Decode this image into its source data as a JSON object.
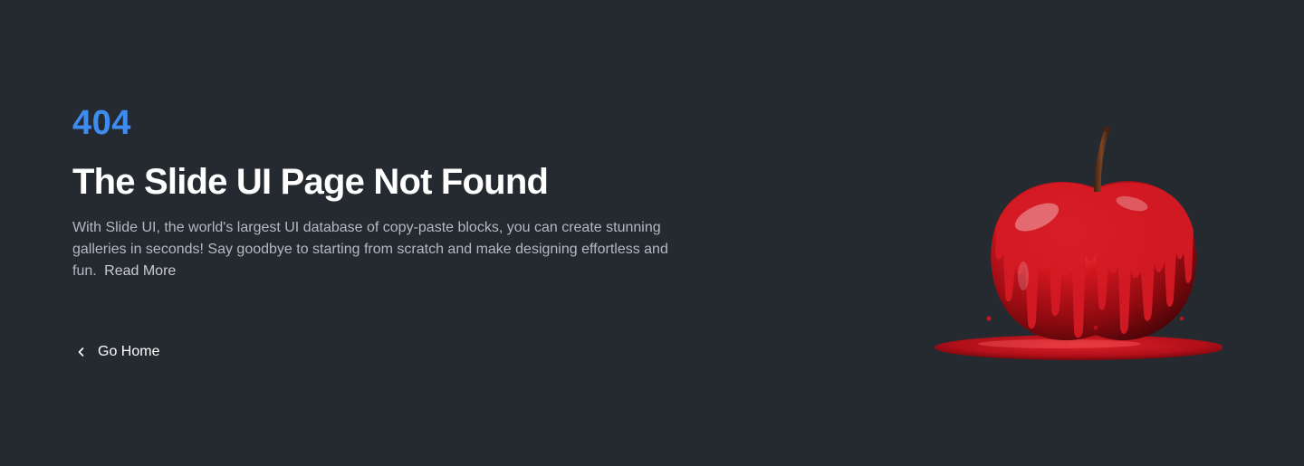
{
  "error": {
    "code": "404",
    "title": "The Slide UI Page Not Found",
    "description": "With Slide UI, the world's largest UI database of copy-paste blocks, you can create stunning galleries in seconds! Say goodbye to starting from scratch and make designing effortless and fun.",
    "read_more_label": "Read More"
  },
  "actions": {
    "go_home_label": "Go Home",
    "go_home_icon": "chevron-left-icon"
  },
  "illustration": {
    "name": "melting-red-apple",
    "colors": {
      "apple": "#c8141e",
      "stem": "#6b3a1f",
      "background": "#252a31",
      "accent": "#3f8cf0"
    }
  }
}
